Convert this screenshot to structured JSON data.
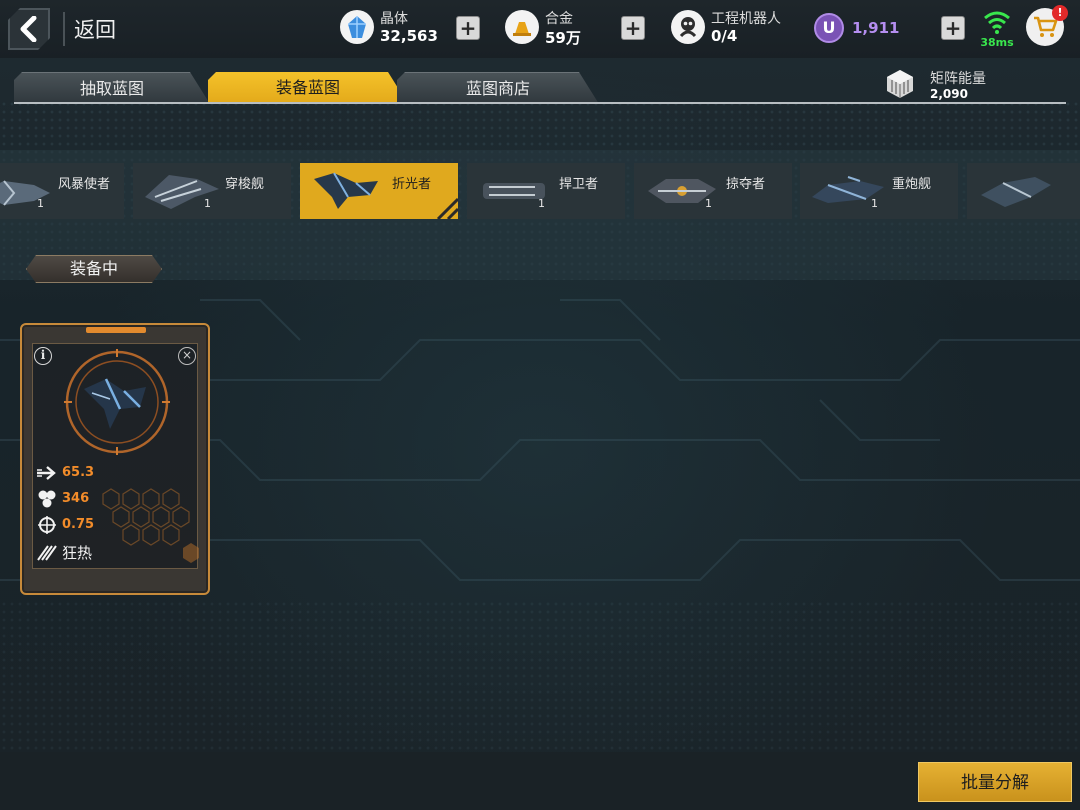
{
  "header": {
    "back_label": "返回",
    "resources": [
      {
        "label": "晶体",
        "value": "32,563",
        "icon": "crystal-icon"
      },
      {
        "label": "合金",
        "value": "59万",
        "icon": "alloy-icon"
      },
      {
        "label": "工程机器人",
        "value": "0/4",
        "icon": "robot-icon"
      }
    ],
    "premium_value": "1,911",
    "premium_letter": "U",
    "ping": "38ms",
    "cart_badge": "!"
  },
  "tabs": [
    {
      "label": "抽取蓝图",
      "active": false
    },
    {
      "label": "装备蓝图",
      "active": true
    },
    {
      "label": "蓝图商店",
      "active": false
    }
  ],
  "matrix_energy": {
    "label": "矩阵能量",
    "value": "2,090"
  },
  "ships": [
    {
      "name": "风暴使者",
      "count": "1",
      "selected": false
    },
    {
      "name": "穿梭舰",
      "count": "1",
      "selected": false
    },
    {
      "name": "折光者",
      "count": "",
      "selected": true
    },
    {
      "name": "捍卫者",
      "count": "1",
      "selected": false
    },
    {
      "name": "掠夺者",
      "count": "1",
      "selected": false
    },
    {
      "name": "重炮舰",
      "count": "1",
      "selected": false
    },
    {
      "name": "",
      "count": "",
      "selected": false
    }
  ],
  "blueprint": {
    "info_symbol": "i",
    "close_symbol": "×",
    "stats": [
      {
        "icon": "speed-arrow-icon",
        "value": "65.3"
      },
      {
        "icon": "shield-cells-icon",
        "value": "346"
      },
      {
        "icon": "crosshair-icon",
        "value": "0.75"
      },
      {
        "icon": "frenzy-icon",
        "value": "狂热"
      }
    ],
    "status": "装备中"
  },
  "actions": {
    "batch_decompose": "批量分解"
  },
  "colors": {
    "accent": "#e3a91a",
    "stat": "#f28c2a",
    "premium": "#b58ef0",
    "ping": "#39e64d"
  }
}
